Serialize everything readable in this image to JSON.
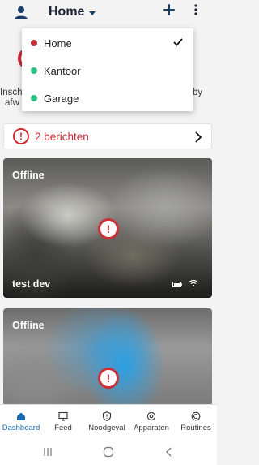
{
  "header": {
    "title": "Home",
    "icons": {
      "user": "user-icon",
      "add": "plus-icon",
      "menu": "kebab-menu-icon"
    }
  },
  "background": {
    "left_text": [
      "Insch",
      "afw"
    ],
    "right_text": [
      "by",
      ""
    ]
  },
  "dropdown": {
    "items": [
      {
        "label": "Home",
        "dot_color": "#c0303c",
        "selected": true
      },
      {
        "label": "Kantoor",
        "dot_color": "#2fbf80",
        "selected": false
      },
      {
        "label": "Garage",
        "dot_color": "#2fbf80",
        "selected": false
      }
    ]
  },
  "messages": {
    "label": "2 berichten",
    "icon": "alert-icon",
    "color": "#c62b33"
  },
  "cards": [
    {
      "status": "Offline",
      "name": "test dev",
      "alert_icon": "alert-icon",
      "battery_icon": "battery-icon",
      "wifi_icon": "wifi-icon"
    },
    {
      "status": "Offline",
      "alert_icon": "alert-icon"
    }
  ],
  "nav": {
    "items": [
      {
        "label": "Dashboard",
        "icon": "home-icon",
        "active": true
      },
      {
        "label": "Feed",
        "icon": "monitor-icon",
        "active": false
      },
      {
        "label": "Noodgeval",
        "icon": "shield-alert-icon",
        "active": false
      },
      {
        "label": "Apparaten",
        "icon": "camera-device-icon",
        "active": false
      },
      {
        "label": "Routines",
        "icon": "routine-icon",
        "active": false
      }
    ],
    "active_color": "#1a6ab0"
  },
  "system_nav": [
    "recent-apps-icon",
    "home-circle-icon",
    "back-icon"
  ]
}
